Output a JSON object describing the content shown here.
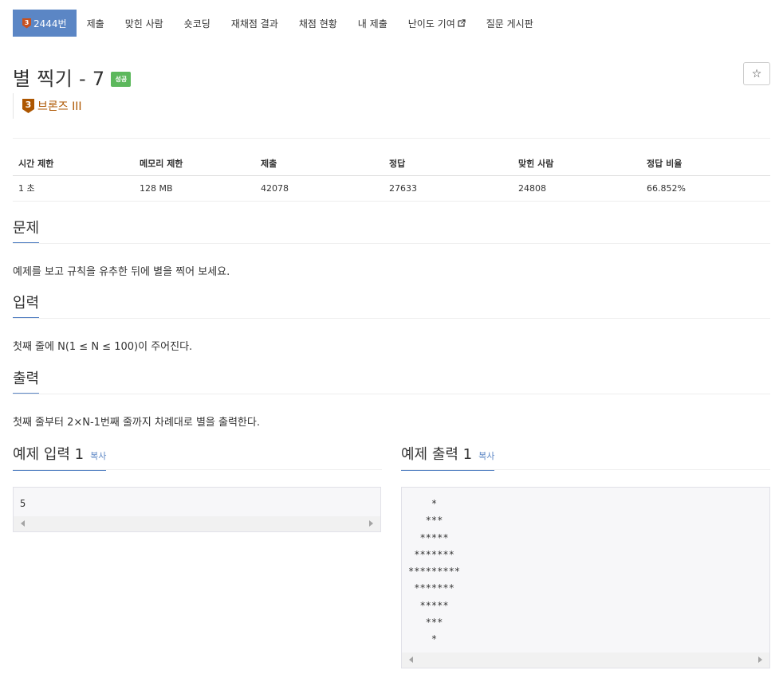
{
  "nav": {
    "items": [
      {
        "label": "2444번",
        "tier": "3"
      },
      {
        "label": "제출"
      },
      {
        "label": "맞힌 사람"
      },
      {
        "label": "숏코딩"
      },
      {
        "label": "재채점 결과"
      },
      {
        "label": "채점 현황"
      },
      {
        "label": "내 제출"
      },
      {
        "label": "난이도 기여"
      },
      {
        "label": "질문 게시판"
      }
    ]
  },
  "problem": {
    "title": "별 찍기 - 7",
    "result_badge": "성공",
    "star_icon": "☆",
    "tier_number": "3",
    "tier_label": "브론즈 III"
  },
  "info_table": {
    "headers": [
      "시간 제한",
      "메모리 제한",
      "제출",
      "정답",
      "맞힌 사람",
      "정답 비율"
    ],
    "values": [
      "1 초",
      "128 MB",
      "42078",
      "27633",
      "24808",
      "66.852%"
    ]
  },
  "sections": {
    "description": {
      "title": "문제",
      "text": "예제를 보고 규칙을 유추한 뒤에 별을 찍어 보세요."
    },
    "input": {
      "title": "입력",
      "text": "첫째 줄에 N(1 ≤ N ≤ 100)이 주어진다."
    },
    "output": {
      "title": "출력",
      "text": "첫째 줄부터 2×N-1번째 줄까지 차례대로 별을 출력한다."
    }
  },
  "samples": {
    "input_title": "예제 입력 1",
    "output_title": "예제 출력 1",
    "copy_label": "복사",
    "input_text": "5",
    "output_text": "    *\n   ***\n  *****\n *******\n*********\n *******\n  *****\n   ***\n    *"
  },
  "colors": {
    "accent": "#5b86c5",
    "success": "#5cb85c",
    "bronze": "#ad5600"
  }
}
